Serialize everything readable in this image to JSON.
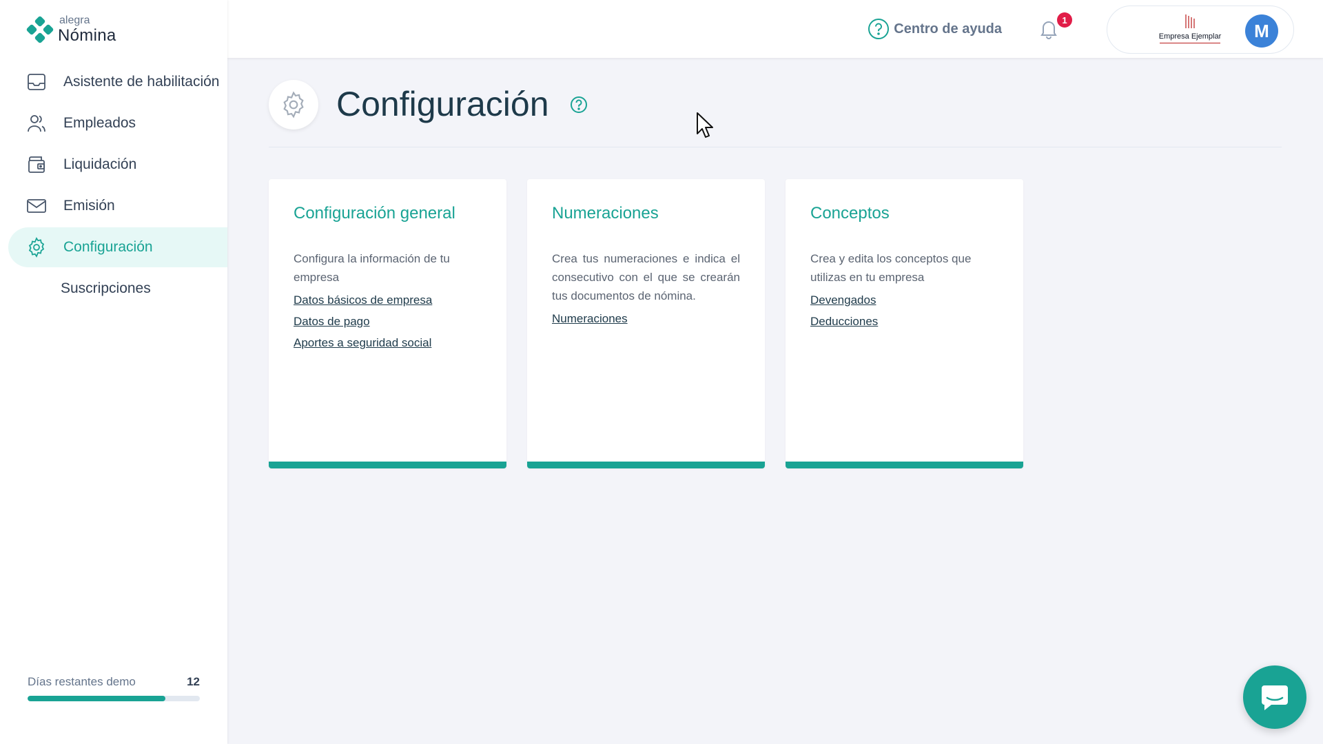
{
  "brand": {
    "small": "alegra",
    "big": "Nómina",
    "accent": "#19a394"
  },
  "sidebar": {
    "items": [
      {
        "label": "Asistente de habilitación",
        "icon": "inbox-icon"
      },
      {
        "label": "Empleados",
        "icon": "users-icon"
      },
      {
        "label": "Liquidación",
        "icon": "wallet-icon"
      },
      {
        "label": "Emisión",
        "icon": "mail-icon"
      },
      {
        "label": "Configuración",
        "icon": "gear-icon",
        "active": true
      },
      {
        "label": "Suscripciones"
      }
    ],
    "demo": {
      "label": "Días restantes demo",
      "days": "12",
      "progress_fraction": 0.8
    }
  },
  "topbar": {
    "help_label": "Centro de ayuda",
    "notification_count": "1",
    "company_name": "Empresa Ejemplar",
    "avatar_initial": "M"
  },
  "page": {
    "title": "Configuración"
  },
  "cards": [
    {
      "title": "Configuración general",
      "description": "Configura la información de tu empresa",
      "links": [
        "Datos básicos de empresa",
        "Datos de pago",
        "Aportes a seguridad social"
      ]
    },
    {
      "title": "Numeraciones",
      "description": "Crea tus numeraciones e indica el consecutivo con el que se crearán tus documentos de nómina.",
      "links": [
        "Numeraciones"
      ]
    },
    {
      "title": "Conceptos",
      "description": "Crea y edita los conceptos que utilizas en tu empresa",
      "links": [
        "Devengados",
        "Deducciones"
      ]
    }
  ]
}
